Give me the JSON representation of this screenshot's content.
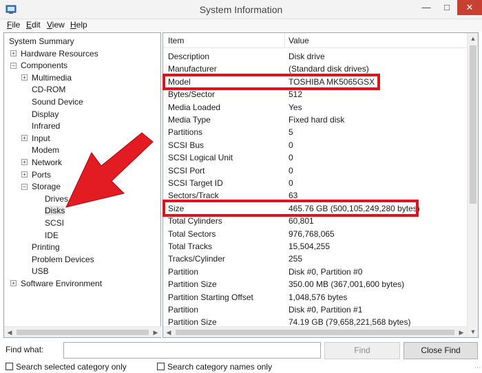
{
  "window": {
    "title": "System Information"
  },
  "menu": [
    {
      "key": "F",
      "rest": "ile"
    },
    {
      "key": "E",
      "rest": "dit"
    },
    {
      "key": "V",
      "rest": "iew"
    },
    {
      "key": "H",
      "rest": "elp"
    }
  ],
  "tree": [
    {
      "label": "System Summary",
      "indent": 0,
      "expander": ""
    },
    {
      "label": "Hardware Resources",
      "indent": 1,
      "expander": "+"
    },
    {
      "label": "Components",
      "indent": 1,
      "expander": "−"
    },
    {
      "label": "Multimedia",
      "indent": 2,
      "expander": "+"
    },
    {
      "label": "CD-ROM",
      "indent": 2,
      "expander": ""
    },
    {
      "label": "Sound Device",
      "indent": 2,
      "expander": ""
    },
    {
      "label": "Display",
      "indent": 2,
      "expander": ""
    },
    {
      "label": "Infrared",
      "indent": 2,
      "expander": ""
    },
    {
      "label": "Input",
      "indent": 2,
      "expander": "+"
    },
    {
      "label": "Modem",
      "indent": 2,
      "expander": ""
    },
    {
      "label": "Network",
      "indent": 2,
      "expander": "+"
    },
    {
      "label": "Ports",
      "indent": 2,
      "expander": "+"
    },
    {
      "label": "Storage",
      "indent": 2,
      "expander": "−"
    },
    {
      "label": "Drives",
      "indent": 3,
      "expander": ""
    },
    {
      "label": "Disks",
      "indent": 3,
      "expander": "",
      "selected": true
    },
    {
      "label": "SCSI",
      "indent": 3,
      "expander": ""
    },
    {
      "label": "IDE",
      "indent": 3,
      "expander": ""
    },
    {
      "label": "Printing",
      "indent": 2,
      "expander": ""
    },
    {
      "label": "Problem Devices",
      "indent": 2,
      "expander": ""
    },
    {
      "label": "USB",
      "indent": 2,
      "expander": ""
    },
    {
      "label": "Software Environment",
      "indent": 1,
      "expander": "+"
    }
  ],
  "list": {
    "headers": {
      "item": "Item",
      "value": "Value"
    },
    "rows": [
      {
        "item": "Description",
        "value": "Disk drive"
      },
      {
        "item": "Manufacturer",
        "value": "(Standard disk drives)"
      },
      {
        "item": "Model",
        "value": "TOSHIBA MK5065GSX",
        "highlight": true
      },
      {
        "item": "Bytes/Sector",
        "value": "512"
      },
      {
        "item": "Media Loaded",
        "value": "Yes"
      },
      {
        "item": "Media Type",
        "value": "Fixed hard disk"
      },
      {
        "item": "Partitions",
        "value": "5"
      },
      {
        "item": "SCSI Bus",
        "value": "0"
      },
      {
        "item": "SCSI Logical Unit",
        "value": "0"
      },
      {
        "item": "SCSI Port",
        "value": "0"
      },
      {
        "item": "SCSI Target ID",
        "value": "0"
      },
      {
        "item": "Sectors/Track",
        "value": "63"
      },
      {
        "item": "Size",
        "value": "465.76 GB (500,105,249,280 bytes)",
        "highlight": true
      },
      {
        "item": "Total Cylinders",
        "value": "60,801"
      },
      {
        "item": "Total Sectors",
        "value": "976,768,065"
      },
      {
        "item": "Total Tracks",
        "value": "15,504,255"
      },
      {
        "item": "Tracks/Cylinder",
        "value": "255"
      },
      {
        "item": "Partition",
        "value": "Disk #0, Partition #0"
      },
      {
        "item": "Partition Size",
        "value": "350.00 MB (367,001,600 bytes)"
      },
      {
        "item": "Partition Starting Offset",
        "value": "1,048,576 bytes"
      },
      {
        "item": "Partition",
        "value": "Disk #0, Partition #1"
      },
      {
        "item": "Partition Size",
        "value": "74.19 GB (79,658,221,568 bytes)"
      }
    ]
  },
  "find": {
    "label": "Find what:",
    "label_key": "w",
    "value": "",
    "find_button": "Find",
    "close_button": "Close Find",
    "check_selected": "Search selected category only",
    "check_names": "Search category names only"
  },
  "colors": {
    "highlight": "#e0121b",
    "arrow": "#e31b23"
  }
}
